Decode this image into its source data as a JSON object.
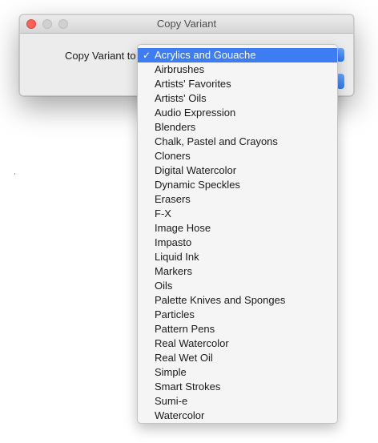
{
  "window": {
    "title": "Copy Variant"
  },
  "form": {
    "label": "Copy Variant to"
  },
  "menu": {
    "checkmark": "✓",
    "selected_index": 0,
    "items": [
      "Acrylics and Gouache",
      "Airbrushes",
      "Artists' Favorites",
      "Artists' Oils",
      "Audio Expression",
      "Blenders",
      "Chalk, Pastel and Crayons",
      "Cloners",
      "Digital Watercolor",
      "Dynamic Speckles",
      "Erasers",
      "F-X",
      "Image Hose",
      "Impasto",
      "Liquid Ink",
      "Markers",
      "Oils",
      "Palette Knives and Sponges",
      "Particles",
      "Pattern Pens",
      "Real Watercolor",
      "Real Wet Oil",
      "Simple",
      "Smart Strokes",
      "Sumi-e",
      "Watercolor"
    ]
  },
  "colors": {
    "selection": "#3d7cf2",
    "close_button": "#fc605b",
    "accent": "#2f7cf6"
  },
  "icons": {
    "close": "close-icon",
    "minimize": "minimize-icon",
    "maximize": "maximize-icon",
    "checkmark": "checkmark-icon"
  }
}
